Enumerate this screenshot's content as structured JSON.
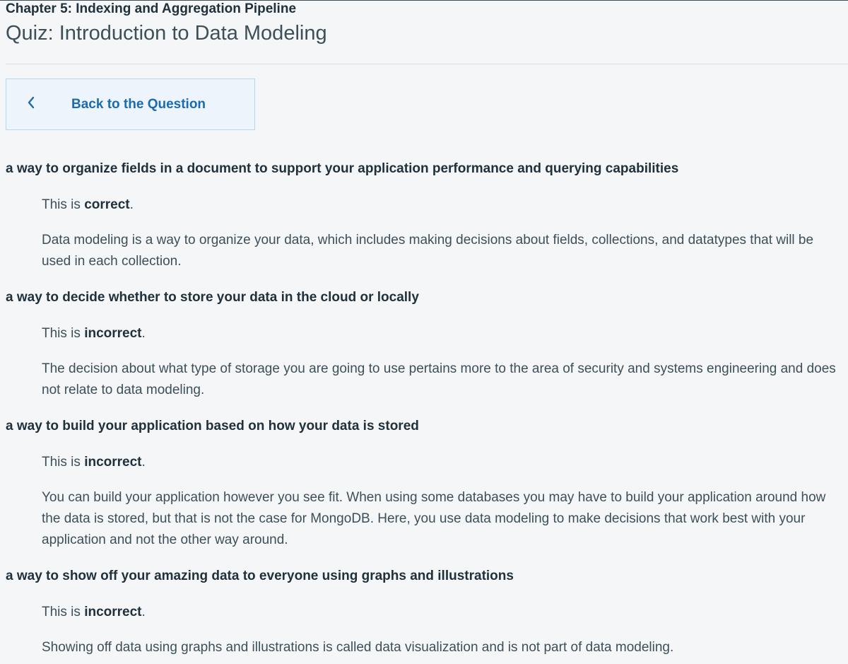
{
  "header": {
    "chapter": "Chapter 5: Indexing and Aggregation Pipeline",
    "title": "Quiz: Introduction to Data Modeling"
  },
  "back_button": {
    "label": "Back to the Question",
    "icon": "chevron-left-icon"
  },
  "answers": [
    {
      "option": "a way to organize fields in a document to support your application performance and querying capabilities",
      "verdict_prefix": "This is ",
      "verdict": "correct",
      "verdict_suffix": ".",
      "explanation": "Data modeling is a way to organize your data, which includes making decisions about fields, collections, and datatypes that will be used in each collection."
    },
    {
      "option": "a way to decide whether to store your data in the cloud or locally",
      "verdict_prefix": "This is ",
      "verdict": "incorrect",
      "verdict_suffix": ".",
      "explanation": "The decision about what type of storage you are going to use pertains more to the area of security and systems engineering and does not relate to data modeling."
    },
    {
      "option": "a way to build your application based on how your data is stored",
      "verdict_prefix": "This is ",
      "verdict": "incorrect",
      "verdict_suffix": ".",
      "explanation": "You can build your application however you see fit. When using some databases you may have to build your application around how the data is stored, but that is not the case for MongoDB. Here, you use data modeling to make decisions that work best with your application and not the other way around."
    },
    {
      "option": "a way to show off your amazing data to everyone using graphs and illustrations",
      "verdict_prefix": "This is ",
      "verdict": "incorrect",
      "verdict_suffix": ".",
      "explanation": "Showing off data using graphs and illustrations is called data visualization and is not part of data modeling."
    }
  ],
  "colors": {
    "accent": "#1a6bb0",
    "button_bg": "#eef4fb",
    "button_border": "#b5d6f0",
    "page_bg": "#f5f6f7"
  }
}
